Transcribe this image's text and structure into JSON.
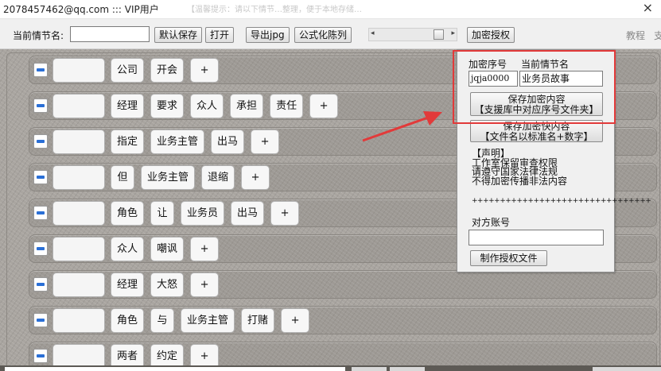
{
  "window": {
    "title": "2078457462@qq.com ::: VIP用户",
    "ghost_text": "【温馨提示：请以下情节…整理，便于本地存储…",
    "close_glyph": "×"
  },
  "toolbar": {
    "scene_label": "当前情节名:",
    "scene_value": "",
    "save_default": "默认保存",
    "open": "打开",
    "export_jpg": "导出jpg",
    "formula_columns": "公式化陈列",
    "scroll_left": "◂",
    "scroll_right": "▸",
    "encrypt_auth": "加密授权",
    "tutorial": "教程",
    "support": "支"
  },
  "rows": [
    {
      "chips": [
        "公司",
        "开会"
      ]
    },
    {
      "chips": [
        "经理",
        "要求",
        "众人",
        "承担",
        "责任"
      ]
    },
    {
      "chips": [
        "指定",
        "业务主管",
        "出马"
      ]
    },
    {
      "chips": [
        "但",
        "业务主管",
        "退缩"
      ]
    },
    {
      "chips": [
        "角色",
        "让",
        "业务员",
        "出马"
      ]
    },
    {
      "chips": [
        "众人",
        "嘲讽"
      ]
    },
    {
      "chips": [
        "经理",
        "大怒"
      ]
    },
    {
      "chips": [
        "角色",
        "与",
        "业务主管",
        "打赌"
      ]
    },
    {
      "chips": [
        "两者",
        "约定"
      ]
    }
  ],
  "add_chip": "+",
  "popup": {
    "seq_label": "加密序号",
    "name_label": "当前情节名",
    "seq_value": "jqja0000",
    "name_value": "业务员故事",
    "save_encrypted_line1": "保存加密内容",
    "save_encrypted_line2": "【支援库中对应序号文件夹】",
    "save_fast_line1": "保存加密快内容",
    "save_fast_line2": "【文件名以标准名+数字】",
    "notice_title": "【声明】",
    "notice_1": "工作室保留审查权限",
    "notice_2": "请遵守国家法律法规",
    "notice_3": "不得加密传播非法内容",
    "divider": "++++++++++++++++++++++++++++++++",
    "account_label": "对方账号",
    "account_value": "",
    "make_auth_file": "制作授权文件"
  },
  "colors": {
    "highlight": "#e23a3a",
    "arrow": "#e23a3a",
    "minus_icon": "#2a6fd6",
    "canvas": "#a9a5a0"
  }
}
